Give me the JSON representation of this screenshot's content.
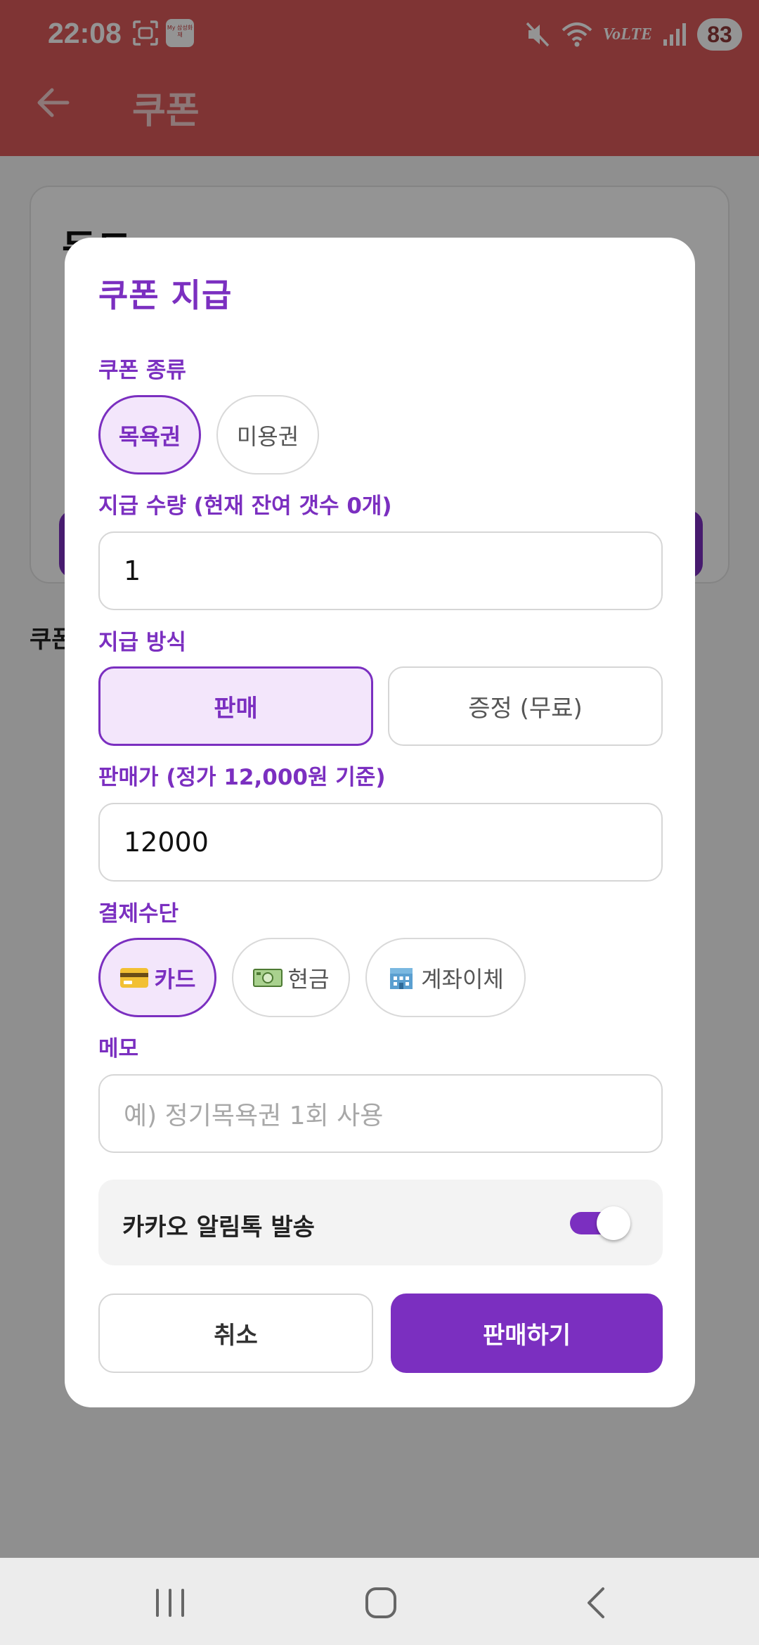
{
  "status_bar": {
    "time": "22:08",
    "app_badge": "My 삼성화재",
    "network": "VoLTE",
    "battery": "83"
  },
  "toolbar": {
    "title": "쿠폰"
  },
  "background": {
    "card_heading": "등드",
    "section_title": "쿠폰"
  },
  "dialog": {
    "title": "쿠폰 지급",
    "coupon_type": {
      "label": "쿠폰 종류",
      "options": [
        "목욕권",
        "미용권"
      ],
      "selected": "목욕권"
    },
    "quantity": {
      "label": "지급 수량 (현재 잔여 갯수 0개)",
      "value": "1"
    },
    "method": {
      "label": "지급 방식",
      "options": [
        "판매",
        "증정 (무료)"
      ],
      "selected": "판매"
    },
    "price": {
      "label": "판매가 (정가 12,000원 기준)",
      "value": "12000"
    },
    "payment": {
      "label": "결제수단",
      "options": [
        "카드",
        "현금",
        "계좌이체"
      ],
      "icons": [
        "credit-card-icon",
        "cash-icon",
        "bank-icon"
      ],
      "selected": "카드"
    },
    "memo": {
      "label": "메모",
      "placeholder": "예) 정기목욕권 1회 사용"
    },
    "kakao": {
      "label": "카카오 알림톡 발송",
      "enabled": true
    },
    "cancel_label": "취소",
    "submit_label": "판매하기"
  },
  "colors": {
    "accent": "#7b2fc0",
    "accent_light": "#f3e6fb",
    "header": "#db5a5a"
  }
}
